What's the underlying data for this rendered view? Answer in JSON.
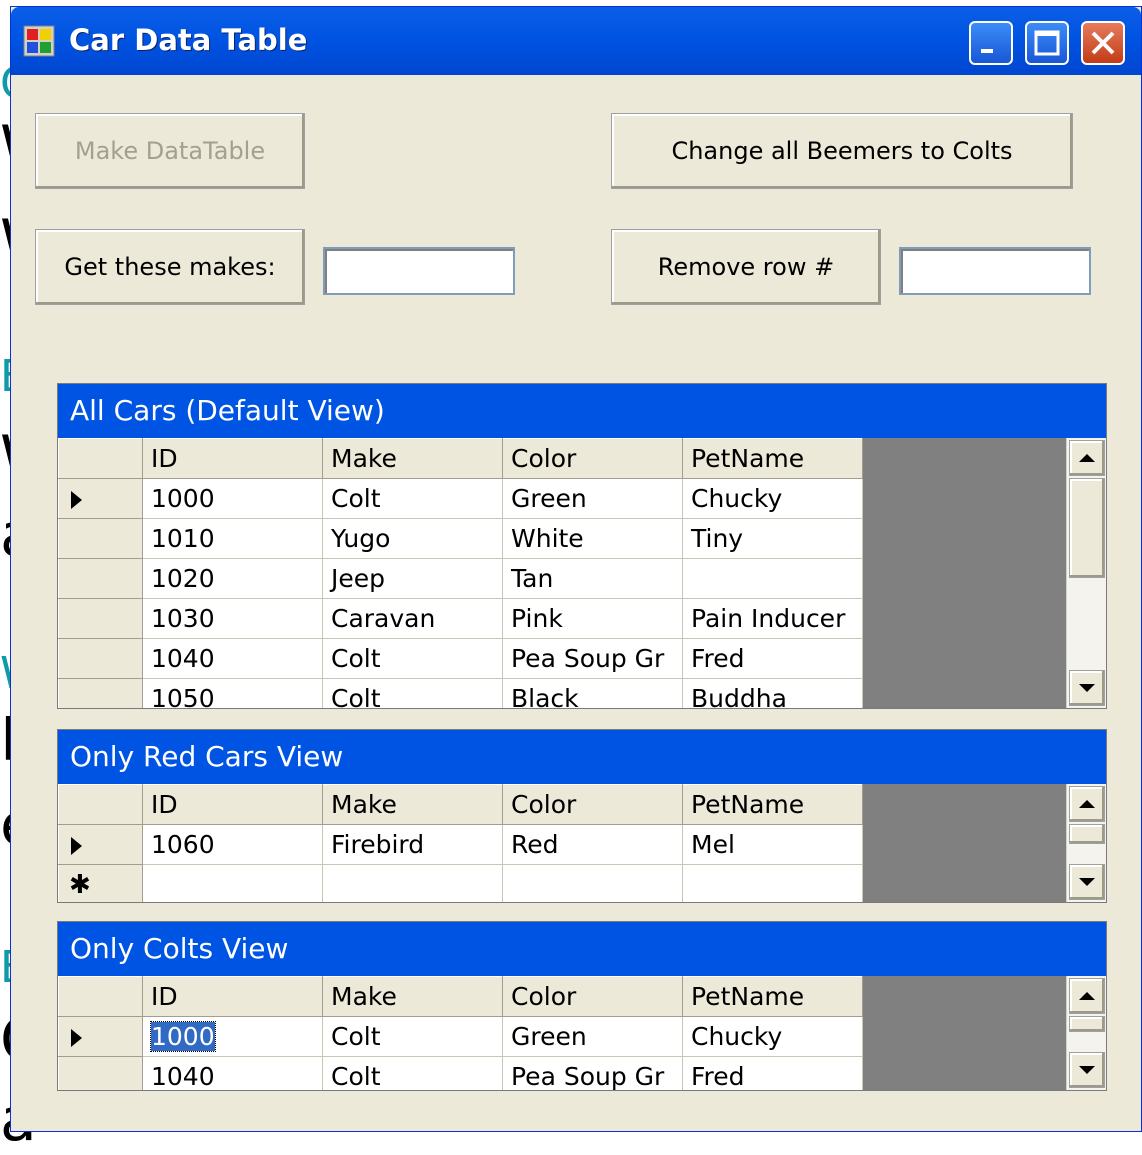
{
  "window": {
    "title": "Car Data Table"
  },
  "buttons": {
    "make_datatable": "Make DataTable",
    "change_beemers": "Change all Beemers to Colts",
    "get_makes": "Get these makes:",
    "remove_row": "Remove row #"
  },
  "inputs": {
    "makes_value": "",
    "row_value": ""
  },
  "columns": [
    "ID",
    "Make",
    "Color",
    "PetName"
  ],
  "all_cars": {
    "caption": "All Cars (Default View)",
    "rows": [
      [
        "1000",
        "Colt",
        "Green",
        "Chucky"
      ],
      [
        "1010",
        "Yugo",
        "White",
        "Tiny"
      ],
      [
        "1020",
        "Jeep",
        "Tan",
        ""
      ],
      [
        "1030",
        "Caravan",
        "Pink",
        "Pain Inducer"
      ],
      [
        "1040",
        "Colt",
        "Pea Soup Gr",
        "Fred"
      ],
      [
        "1050",
        "Colt",
        "Black",
        "Buddha"
      ]
    ]
  },
  "red_cars": {
    "caption": "Only Red Cars View",
    "rows": [
      [
        "1060",
        "Firebird",
        "Red",
        "Mel"
      ]
    ],
    "new_row_marker": "✱"
  },
  "colts": {
    "caption": "Only Colts View",
    "rows": [
      [
        "1000",
        "Colt",
        "Green",
        "Chucky"
      ],
      [
        "1040",
        "Colt",
        "Pea Soup Gr",
        "Fred"
      ]
    ]
  },
  "background_fragments": [
    "C",
    "W",
    "W",
    "E",
    "W",
    "a",
    "W",
    "F",
    "e",
    "E",
    "C",
    "a"
  ]
}
